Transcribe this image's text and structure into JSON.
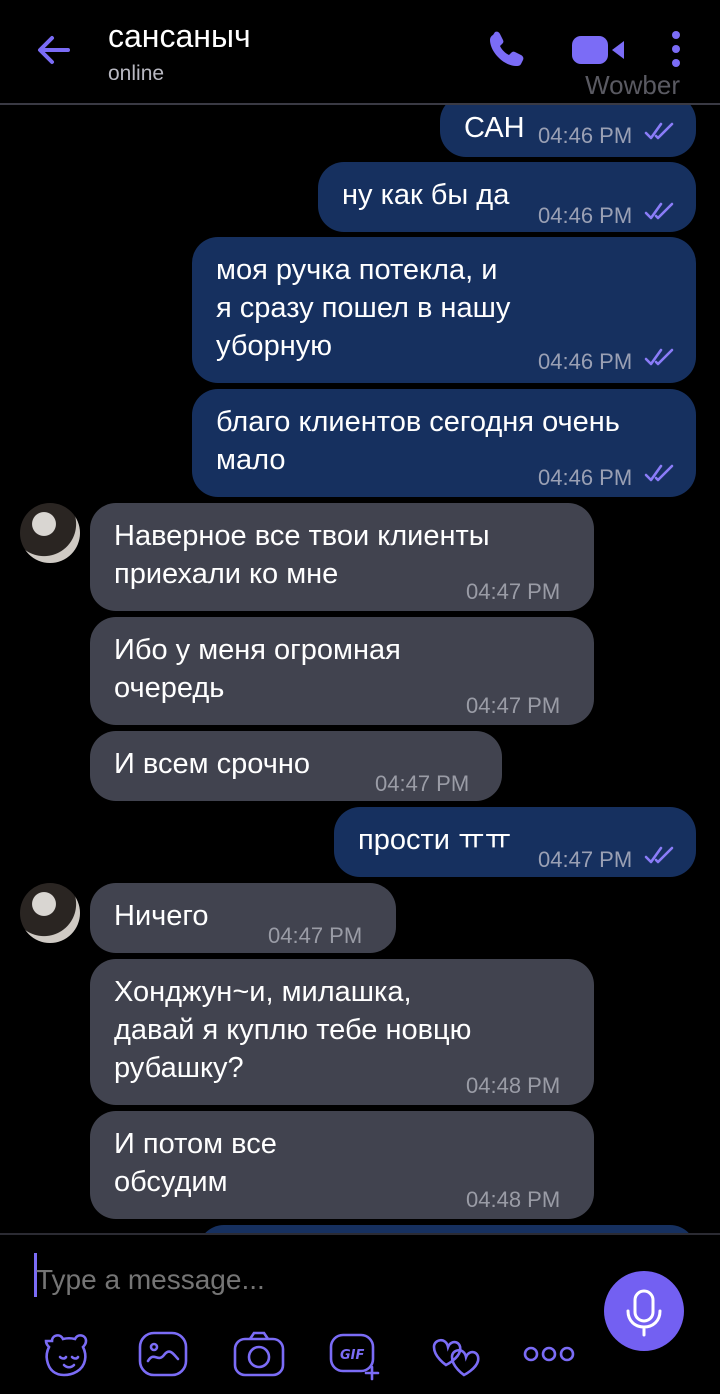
{
  "header": {
    "contact_name": "сансаныч",
    "status": "online",
    "watermark": "Wowber"
  },
  "colors": {
    "accent": "#7360f2",
    "outgoing": "#16305f",
    "incoming": "#41434f"
  },
  "messages": [
    {
      "dir": "out",
      "text": "САН",
      "time": "04:46 PM",
      "read": true
    },
    {
      "dir": "out",
      "text": "ну как бы да",
      "time": "04:46 PM",
      "read": true
    },
    {
      "dir": "out",
      "text": "моя ручка потекла, и\nя сразу пошел в нашу\nуборную",
      "time": "04:46 PM",
      "read": true
    },
    {
      "dir": "out",
      "text": "благо клиентов сегодня очень\nмало",
      "time": "04:46 PM",
      "read": true
    },
    {
      "dir": "in",
      "text": "Наверное все твои клиенты\nприехали ко мне",
      "time": "04:47 PM"
    },
    {
      "dir": "in",
      "text": "Ибо у меня огромная\nочередь",
      "time": "04:47 PM"
    },
    {
      "dir": "in",
      "text": "И всем срочно",
      "time": "04:47 PM"
    },
    {
      "dir": "out",
      "text": "прости ㅠㅠ",
      "time": "04:47 PM",
      "read": true
    },
    {
      "dir": "in",
      "text": "Ничего",
      "time": "04:47 PM"
    },
    {
      "dir": "in",
      "text": "Хонджун~и, милашка,\nдавай я куплю тебе новцю\nрубашку?",
      "time": "04:48 PM"
    },
    {
      "dir": "in",
      "text": "И потом все\nобсудим",
      "time": "04:48 PM"
    }
  ],
  "composer": {
    "placeholder": "Type a message...",
    "tools": [
      "sticker-icon",
      "doodle-icon",
      "camera-icon",
      "gif-icon",
      "emoji-love-icon",
      "more-icon"
    ]
  }
}
